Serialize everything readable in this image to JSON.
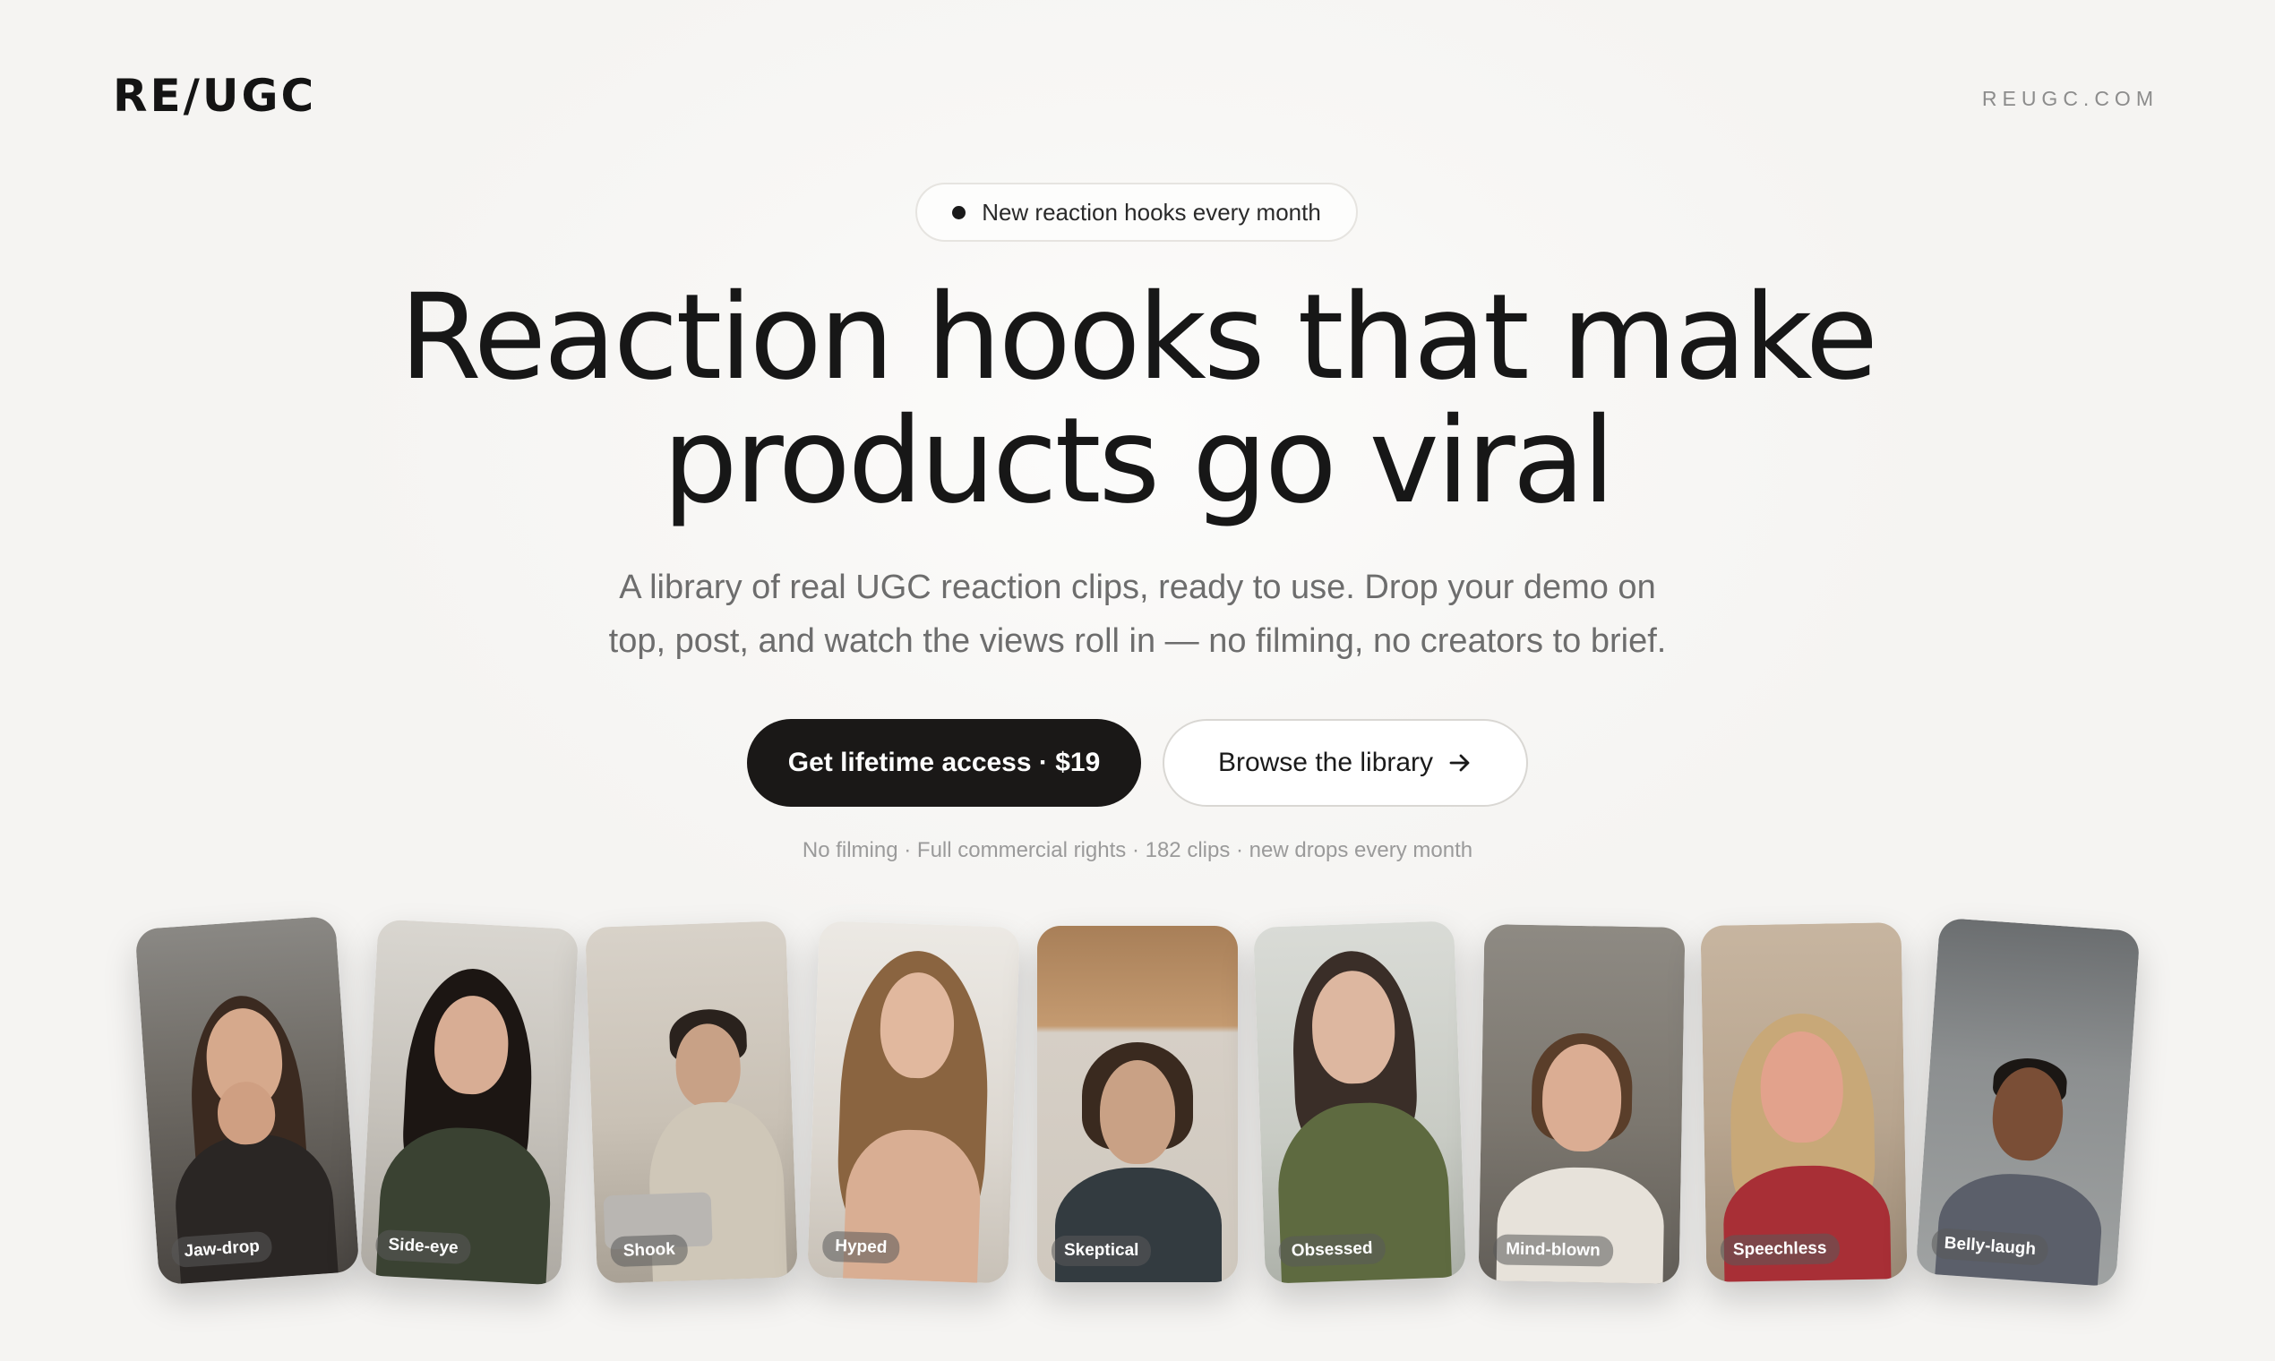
{
  "header": {
    "logo": "RE/UGC",
    "domain": "REUGC.COM"
  },
  "hero": {
    "badge": "New reaction hooks every month",
    "headline_line1": "Reaction hooks that make",
    "headline_line2": "products go viral",
    "subcopy_line1": "A library of real UGC reaction clips, ready to use. Drop your demo on",
    "subcopy_line2": "top, post, and watch the views roll in — no filming, no creators to brief.",
    "primary_cta": "Get lifetime access · $19",
    "secondary_cta": "Browse the library",
    "fineprint": "No filming · Full commercial rights · 182 clips · new drops every month"
  },
  "clips": [
    {
      "label": "Jaw-drop"
    },
    {
      "label": "Side-eye"
    },
    {
      "label": "Shook"
    },
    {
      "label": "Hyped"
    },
    {
      "label": "Skeptical"
    },
    {
      "label": "Obsessed"
    },
    {
      "label": "Mind-blown"
    },
    {
      "label": "Speechless"
    },
    {
      "label": "Belly-laugh"
    }
  ],
  "icons": {
    "secondary_cta_icon": "arrow-right-icon",
    "badge_icon": "dot-icon"
  },
  "colors": {
    "background": "#f6f5f3",
    "primary_button": "#1a1817",
    "text": "#171717",
    "muted_text": "#6d6d6d"
  }
}
